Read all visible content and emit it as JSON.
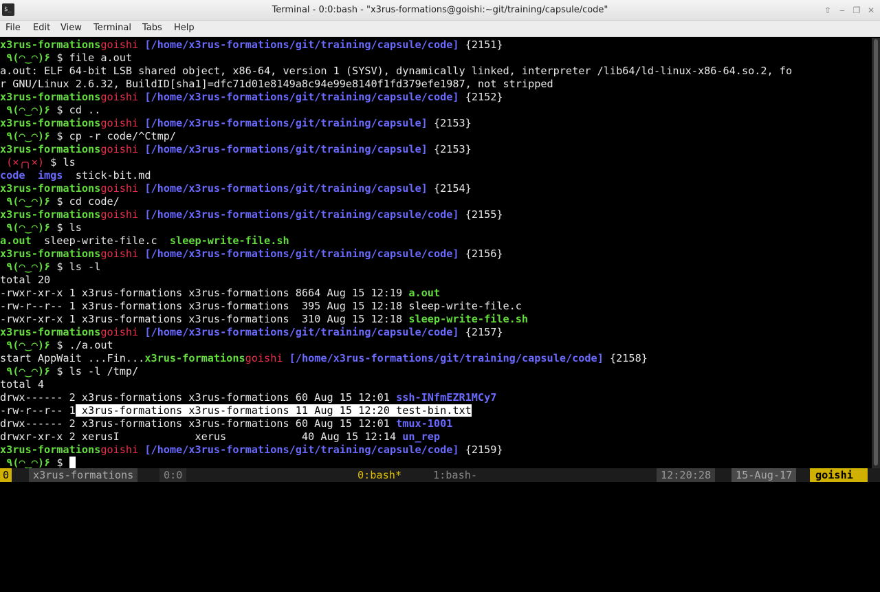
{
  "window": {
    "title": "Terminal - 0:0:bash - \"x3rus-formations@goishi:~git/training/capsule/code\"",
    "app_icon_text": "$_"
  },
  "menu": [
    "File",
    "Edit",
    "View",
    "Terminal",
    "Tabs",
    "Help"
  ],
  "terminal": {
    "lines": [
      {
        "type": "prompt",
        "user": "x3rus-formations",
        "host": "goishi",
        "path": "[/home/x3rus-formations/git/training/capsule/code]",
        "num": "{2151}"
      },
      {
        "type": "cmd",
        "face": " ٩(◠‿◠)۶ ",
        "cmd": "file a.out"
      },
      {
        "type": "text",
        "text": "a.out: ELF 64-bit LSB shared object, x86-64, version 1 (SYSV), dynamically linked, interpreter /lib64/ld-linux-x86-64.so.2, fo"
      },
      {
        "type": "text",
        "text": "r GNU/Linux 2.6.32, BuildID[sha1]=dfc71d01e8149a8c94e99e8140f1fd379efe1987, not stripped"
      },
      {
        "type": "prompt",
        "user": "x3rus-formations",
        "host": "goishi",
        "path": "[/home/x3rus-formations/git/training/capsule/code]",
        "num": "{2152}"
      },
      {
        "type": "cmd",
        "face": " ٩(◠‿◠)۶ ",
        "cmd": "cd .."
      },
      {
        "type": "prompt",
        "user": "x3rus-formations",
        "host": "goishi",
        "path": "[/home/x3rus-formations/git/training/capsule]",
        "num": "{2153}"
      },
      {
        "type": "cmd",
        "face": " ٩(◠‿◠)۶ ",
        "cmd": "cp -r code/^Ctmp/"
      },
      {
        "type": "prompt",
        "user": "x3rus-formations",
        "host": "goishi",
        "path": "[/home/x3rus-formations/git/training/capsule]",
        "num": "{2153}"
      },
      {
        "type": "cmd",
        "face": " (×╭╮×) ",
        "err": true,
        "cmd": "ls"
      },
      {
        "type": "ls1",
        "items": [
          "code",
          "imgs",
          "stick-bit.md"
        ]
      },
      {
        "type": "prompt",
        "user": "x3rus-formations",
        "host": "goishi",
        "path": "[/home/x3rus-formations/git/training/capsule]",
        "num": "{2154}"
      },
      {
        "type": "cmd",
        "face": " ٩(◠‿◠)۶ ",
        "cmd": "cd code/"
      },
      {
        "type": "prompt",
        "user": "x3rus-formations",
        "host": "goishi",
        "path": "[/home/x3rus-formations/git/training/capsule/code]",
        "num": "{2155}"
      },
      {
        "type": "cmd",
        "face": " ٩(◠‿◠)۶ ",
        "cmd": "ls"
      },
      {
        "type": "ls2",
        "items": [
          "a.out",
          "sleep-write-file.c",
          "sleep-write-file.sh"
        ]
      },
      {
        "type": "prompt",
        "user": "x3rus-formations",
        "host": "goishi",
        "path": "[/home/x3rus-formations/git/training/capsule/code]",
        "num": "{2156}"
      },
      {
        "type": "cmd",
        "face": " ٩(◠‿◠)۶ ",
        "cmd": "ls -l"
      },
      {
        "type": "text",
        "text": "total 20"
      },
      {
        "type": "lsl",
        "pre": "-rwxr-xr-x 1 x3rus-formations x3rus-formations 8664 Aug 15 12:19 ",
        "name": "a.out",
        "style": "g"
      },
      {
        "type": "lsl",
        "pre": "-rw-r--r-- 1 x3rus-formations x3rus-formations  395 Aug 15 12:18 ",
        "name": "sleep-write-file.c",
        "style": "w"
      },
      {
        "type": "lsl",
        "pre": "-rwxr-xr-x 1 x3rus-formations x3rus-formations  310 Aug 15 12:18 ",
        "name": "sleep-write-file.sh",
        "style": "g"
      },
      {
        "type": "prompt",
        "user": "x3rus-formations",
        "host": "goishi",
        "path": "[/home/x3rus-formations/git/training/capsule/code]",
        "num": "{2157}"
      },
      {
        "type": "cmd",
        "face": " ٩(◠‿◠)۶ ",
        "cmd": "./a.out"
      },
      {
        "type": "prompt",
        "pre": "start AppWait ...Fin...",
        "user": "x3rus-formations",
        "host": "goishi",
        "path": "[/home/x3rus-formations/git/training/capsule/code]",
        "num": "{2158}"
      },
      {
        "type": "cmd",
        "face": " ٩(◠‿◠)۶ ",
        "cmd": "ls -l /tmp/"
      },
      {
        "type": "text",
        "text": "total 4"
      },
      {
        "type": "lsl",
        "pre": "drwx------ 2 x3rus-formations x3rus-formations 60 Aug 15 12:01 ",
        "name": "ssh-INfmEZR1MCy7",
        "style": "b"
      },
      {
        "type": "lsl_hl",
        "pre": "-rw-r--r-- 1",
        "hl": " x3rus-formations x3rus-formations 11 Aug 15 12:20 test-bin.txt"
      },
      {
        "type": "lsl",
        "pre": "drwx------ 2 x3rus-formations x3rus-formations 60 Aug 15 12:01 ",
        "name": "tmux-1001",
        "style": "b"
      },
      {
        "type": "lsl_ib",
        "pre": "drwxr-xr-x 2 xerus",
        "ib": "I",
        "mid": "            xerus            40 Aug 15 12:14 ",
        "name": "un_rep",
        "style": "b"
      },
      {
        "type": "prompt",
        "user": "x3rus-formations",
        "host": "goishi",
        "path": "[/home/x3rus-formations/git/training/capsule/code]",
        "num": "{2159}"
      },
      {
        "type": "cmd",
        "face": " ٩(◠‿◠)۶ ",
        "cmd": "",
        "cursor": true
      }
    ]
  },
  "statusbar": {
    "session_index": "0",
    "session_name": "x3rus-formations",
    "pane": "0:0",
    "win_active": "0:bash*",
    "win_other": "1:bash-",
    "time": "12:20:28",
    "date": "15-Aug-17",
    "host": "goishi"
  },
  "colors": {
    "user": "#63dc3e",
    "host": "#e8304b",
    "path": "#6a6aff",
    "accent": "#d0b000"
  }
}
